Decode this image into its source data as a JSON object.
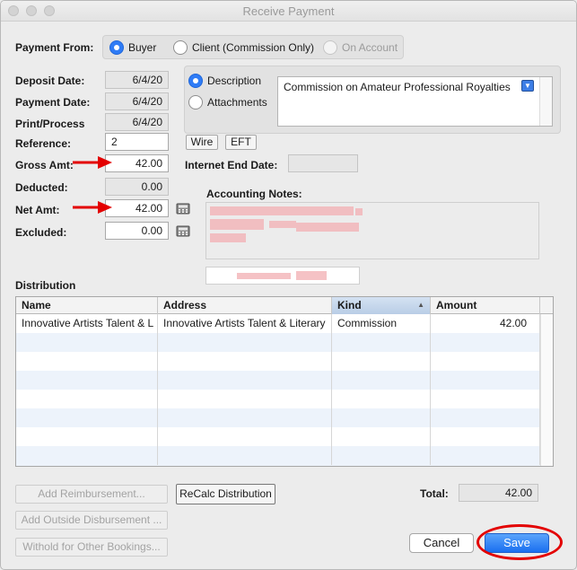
{
  "window": {
    "title": "Receive Payment"
  },
  "payment_from": {
    "label": "Payment From:",
    "options": [
      {
        "label": "Buyer",
        "selected": true,
        "enabled": true
      },
      {
        "label": "Client (Commission Only)",
        "selected": false,
        "enabled": true
      },
      {
        "label": "On Account",
        "selected": false,
        "enabled": false
      }
    ]
  },
  "fields": {
    "deposit_date": {
      "label": "Deposit Date:",
      "value": "6/4/20"
    },
    "payment_date": {
      "label": "Payment Date:",
      "value": "6/4/20"
    },
    "print_process": {
      "label": "Print/Process",
      "value": "6/4/20"
    },
    "reference": {
      "label": "Reference:",
      "value": "2"
    },
    "gross_amt": {
      "label": "Gross Amt:",
      "value": "42.00"
    },
    "deducted": {
      "label": "Deducted:",
      "value": "0.00"
    },
    "net_amt": {
      "label": "Net Amt:",
      "value": "42.00"
    },
    "excluded": {
      "label": "Excluded:",
      "value": "0.00"
    }
  },
  "description_panel": {
    "options": [
      {
        "label": "Description",
        "selected": true
      },
      {
        "label": "Attachments",
        "selected": false
      }
    ],
    "memo_text": "Commission on Amateur Professional Royalties"
  },
  "wire_button": "Wire",
  "eft_button": "EFT",
  "internet_end_date": {
    "label": "Internet End Date:",
    "value": ""
  },
  "accounting_notes": {
    "label": "Accounting Notes:"
  },
  "distribution": {
    "label": "Distribution",
    "columns": [
      "Name",
      "Address",
      "Kind",
      "Amount"
    ],
    "sorted_column": "Kind",
    "rows": [
      {
        "name": "Innovative Artists Talent & L",
        "address": "Innovative Artists Talent & Literary",
        "kind": "Commission",
        "amount": "42.00"
      }
    ]
  },
  "buttons": {
    "add_reimbursement": "Add Reimbursement...",
    "recalc_distribution": "ReCalc Distribution",
    "add_outside_disbursement": "Add Outside Disbursement ...",
    "withold_other_bookings": "Withold for Other Bookings...",
    "cancel": "Cancel",
    "save": "Save"
  },
  "total": {
    "label": "Total:",
    "value": "42.00"
  },
  "colors": {
    "accent": "#2f7cf6",
    "annotation_red": "#e30000",
    "row_alt": "#edf3fb"
  },
  "icons": {
    "calculator": "calculator-icon",
    "dropdown": "chevron-down-icon",
    "sort": "sort-ascending-icon"
  }
}
